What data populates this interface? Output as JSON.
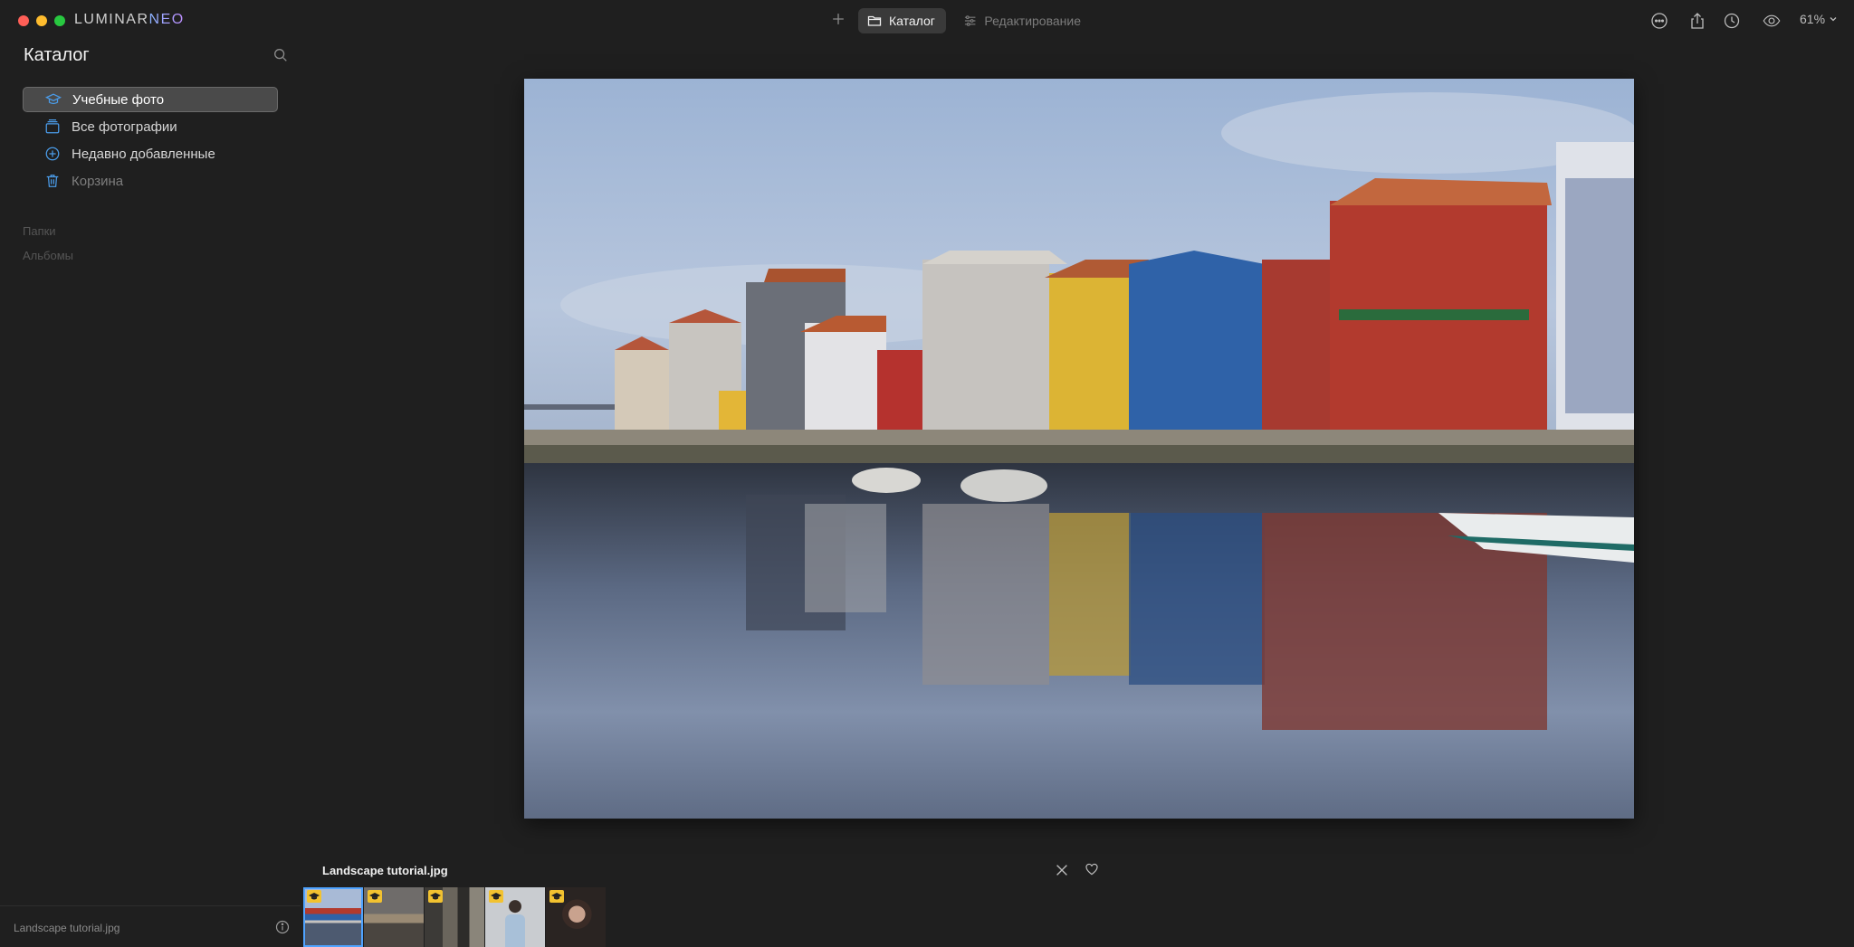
{
  "app": {
    "logo_part1": "LUMINAR",
    "logo_part2": "NEO",
    "tabs": {
      "catalog": "Каталог",
      "edit": "Редактирование"
    },
    "zoom": "61%"
  },
  "sidebar": {
    "title": "Каталог",
    "items": [
      {
        "label": "Учебные фото",
        "icon": "graduation-cap-icon"
      },
      {
        "label": "Все фотографии",
        "icon": "photos-stack-icon"
      },
      {
        "label": "Недавно добавленные",
        "icon": "plus-circle-icon"
      },
      {
        "label": "Корзина",
        "icon": "trash-icon"
      }
    ],
    "sections": {
      "folders": "Папки",
      "albums": "Альбомы"
    },
    "footer_filename": "Landscape tutorial.jpg"
  },
  "filmstrip": {
    "current_filename": "Landscape tutorial.jpg",
    "thumbnails": [
      {
        "name": "thumb-landscape",
        "selected": true
      },
      {
        "name": "thumb-beach",
        "selected": false
      },
      {
        "name": "thumb-street",
        "selected": false
      },
      {
        "name": "thumb-portrait-man",
        "selected": false
      },
      {
        "name": "thumb-portrait-woman",
        "selected": false
      }
    ]
  },
  "colors": {
    "accent": "#4a9be8",
    "selection": "#4fa3ff",
    "badge": "#f2c230"
  }
}
